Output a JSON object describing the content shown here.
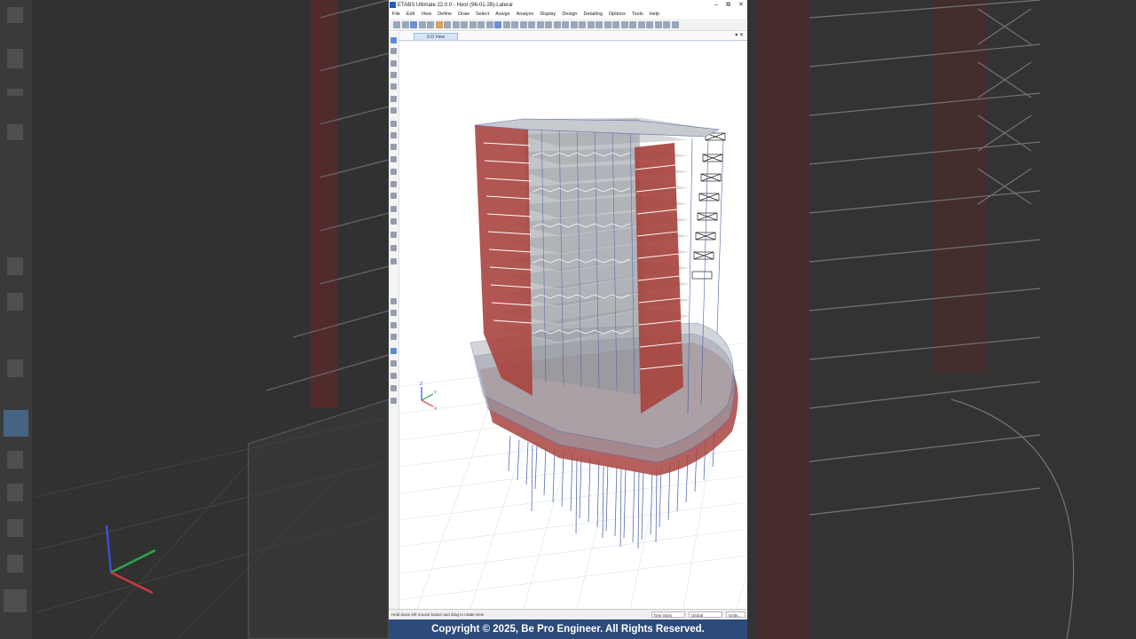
{
  "window": {
    "title": "ETABS Ultimate 22.0.0 - Hoor (96-01-28)-Lateral",
    "minimize": "–",
    "maximize": "⧉",
    "close": "✕"
  },
  "menu": [
    "File",
    "Edit",
    "View",
    "Define",
    "Draw",
    "Select",
    "Assign",
    "Analyze",
    "Display",
    "Design",
    "Detailing",
    "Options",
    "Tools",
    "Help"
  ],
  "view_tab": {
    "label": "3-D View",
    "controls": "▾ ✕"
  },
  "statusbar": {
    "message": "Hold down left mouse button and drag to rotate view",
    "story": "One Story",
    "coord": "Global",
    "units": "Units..."
  },
  "axes": {
    "x": "X",
    "y": "Y",
    "z": "Z"
  },
  "footer": {
    "copyright": "Copyright © 2025, Be Pro Engineer. All Rights Reserved."
  },
  "colors": {
    "banner": "#2c4a7a",
    "shear_wall": "#a8443f",
    "frame": "#4a5fa8",
    "slab": "#8f939a"
  },
  "icons": [
    "etabs-app-icon",
    "pointer-icon",
    "zoom-icon",
    "pan-icon",
    "rotate-icon",
    "draw-beam-icon",
    "draw-wall-icon"
  ]
}
